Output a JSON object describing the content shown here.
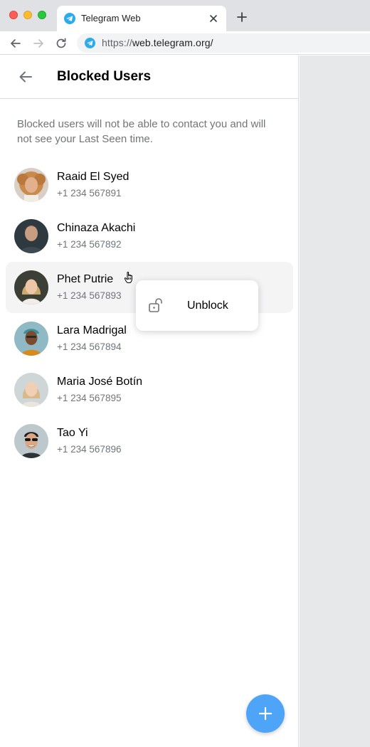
{
  "browser": {
    "tab_title": "Telegram Web",
    "url_scheme": "https://",
    "url_rest": "web.telegram.org/",
    "favicon_color": "#2aabee"
  },
  "header": {
    "title": "Blocked Users"
  },
  "description": "Blocked users will not be able to contact you and will not see your Last Seen time.",
  "users": [
    {
      "name": "Raaid El Syed",
      "phone": "+1 234 567891"
    },
    {
      "name": "Chinaza Akachi",
      "phone": "+1 234 567892"
    },
    {
      "name": "Phet Putrie",
      "phone": "+1 234 567893"
    },
    {
      "name": "Lara Madrigal",
      "phone": "+1 234 567894"
    },
    {
      "name": "Maria José Botín",
      "phone": "+1 234 567895"
    },
    {
      "name": "Tao Yi",
      "phone": "+1 234 567896"
    }
  ],
  "context_menu": {
    "unblock_label": "Unblock"
  },
  "colors": {
    "accent": "#4ea4f6",
    "secondary_text": "#707579"
  }
}
